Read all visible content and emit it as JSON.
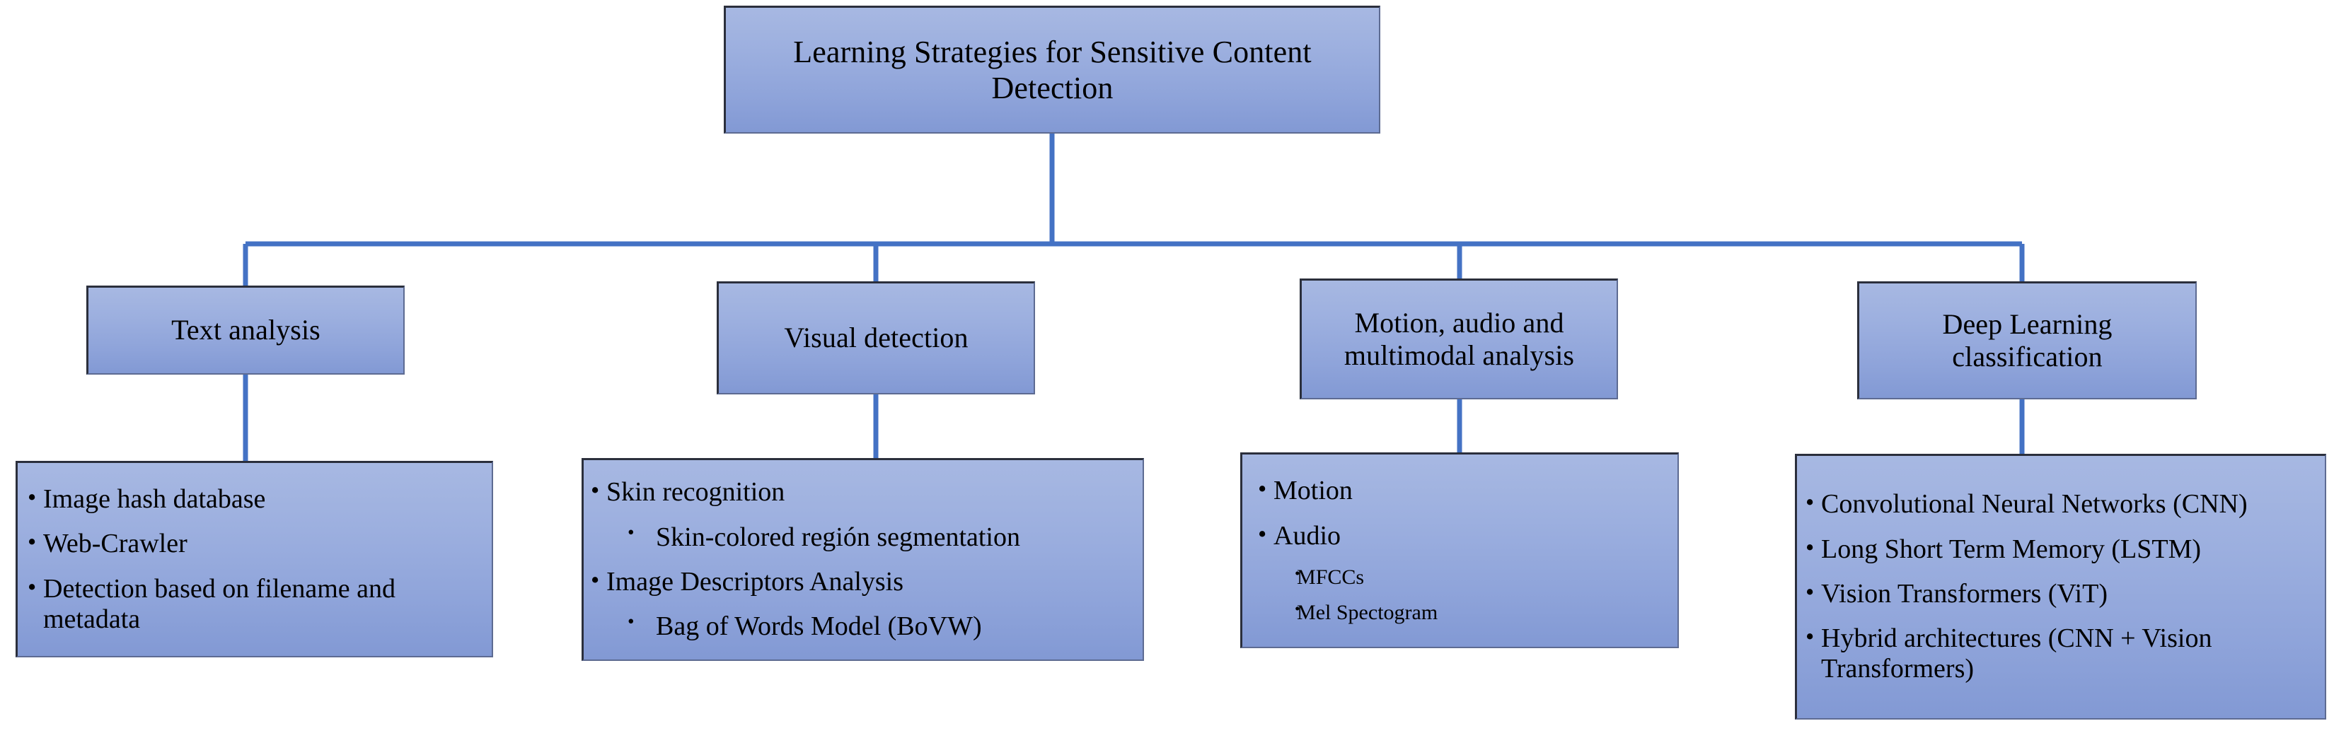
{
  "diagram": {
    "type": "hierarchy-tree",
    "root": {
      "id": "root",
      "label": "Learning Strategies for Sensitive Content Detection"
    },
    "branches": [
      {
        "id": "text-analysis",
        "label": "Text analysis",
        "leaf": {
          "id": "text-analysis-items",
          "items": [
            {
              "level": 1,
              "text": "Image hash database"
            },
            {
              "level": 1,
              "text": "Web-Crawler"
            },
            {
              "level": 1,
              "text": "Detection based on filename and metadata"
            }
          ]
        }
      },
      {
        "id": "visual-detection",
        "label": "Visual detection",
        "leaf": {
          "id": "visual-detection-items",
          "items": [
            {
              "level": 1,
              "text": "Skin recognition"
            },
            {
              "level": 2,
              "text": "Skin-colored región segmentation"
            },
            {
              "level": 1,
              "text": "Image Descriptors Analysis"
            },
            {
              "level": 2,
              "text": "Bag of Words Model (BoVW)"
            }
          ]
        }
      },
      {
        "id": "motion-audio-multimodal",
        "label": "Motion, audio and multimodal analysis",
        "leaf": {
          "id": "motion-audio-multimodal-items",
          "items": [
            {
              "level": 1,
              "text": "Motion"
            },
            {
              "level": 1,
              "text": "Audio"
            },
            {
              "level": 2,
              "text": "MFCCs"
            },
            {
              "level": 2,
              "text": "Mel Spectogram"
            }
          ]
        }
      },
      {
        "id": "deep-learning-classification",
        "label": "Deep Learning classification",
        "leaf": {
          "id": "deep-learning-classification-items",
          "items": [
            {
              "level": 1,
              "text": "Convolutional Neural Networks (CNN)"
            },
            {
              "level": 1,
              "text": "Long Short Term Memory (LSTM)"
            },
            {
              "level": 1,
              "text": "Vision Transformers (ViT)"
            },
            {
              "level": 1,
              "text": "Hybrid architectures (CNN + Vision Transformers)"
            }
          ]
        }
      }
    ],
    "colors": {
      "connector": "#4472c4",
      "box_fill_top": "#a7b8e2",
      "box_fill_bottom": "#8299d4",
      "box_border_dark": "#2b2f3c",
      "box_border_light": "#5d6b92",
      "text": "#000000",
      "background": "#ffffff"
    }
  }
}
